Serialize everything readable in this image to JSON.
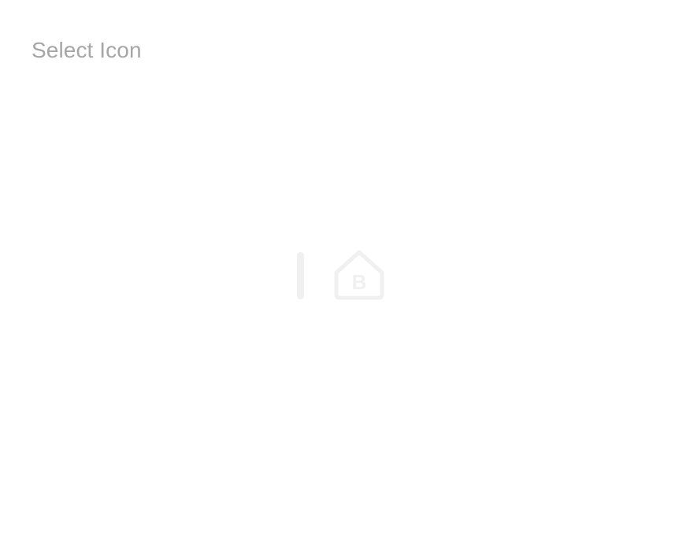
{
  "header": {
    "title": "Select Icon"
  },
  "loader": {
    "bar_icon": "loading-bar-icon",
    "logo_icon": "house-b-logo-icon",
    "logo_letter": "B",
    "color": "#f0f0f0"
  },
  "colors": {
    "background": "#ffffff",
    "title": "#a6a6a6",
    "loader": "#f0f0f0"
  }
}
